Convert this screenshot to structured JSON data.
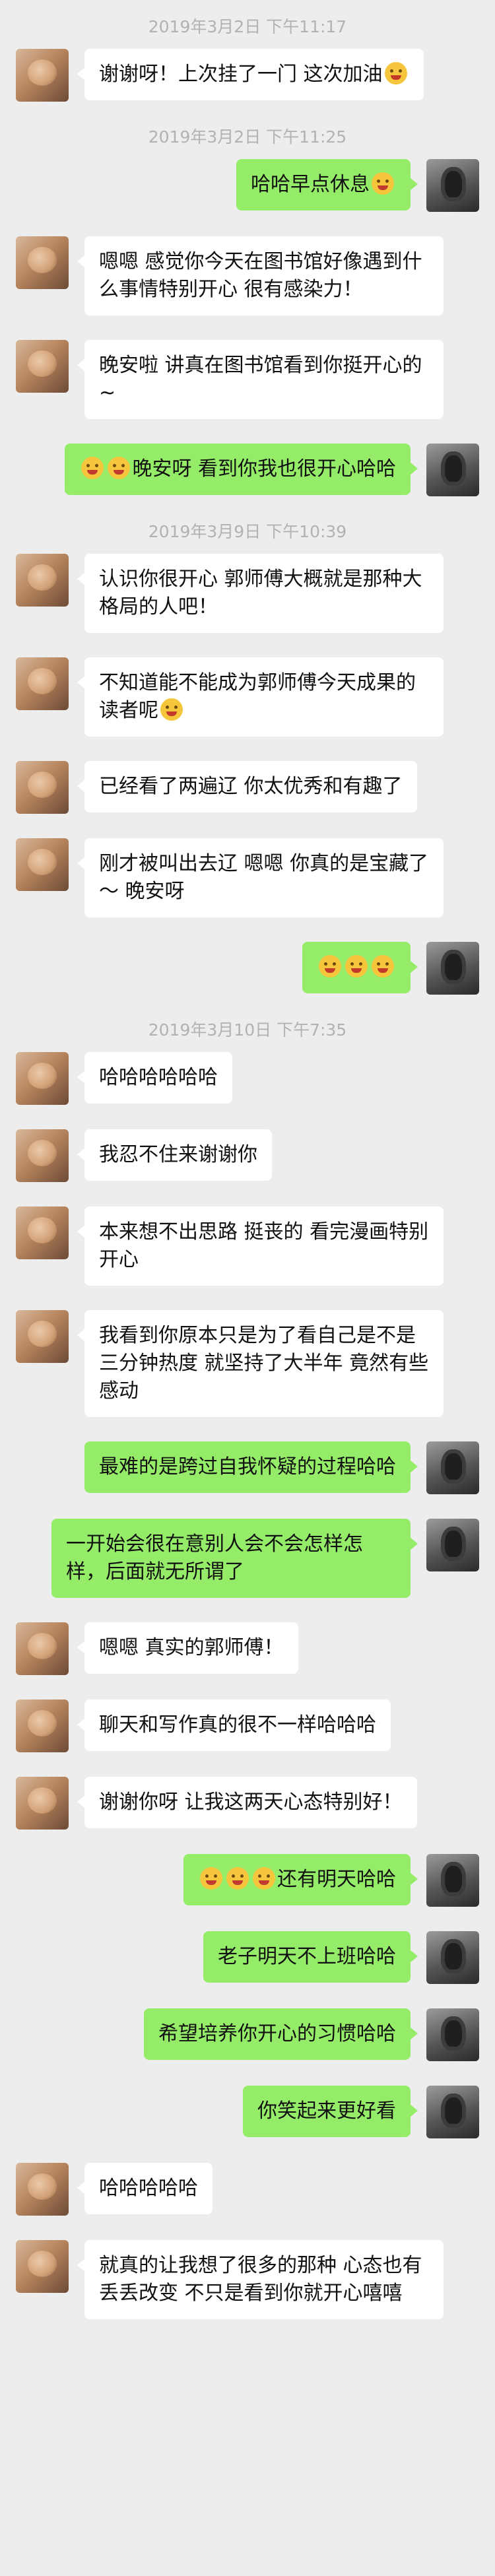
{
  "items": [
    {
      "type": "time",
      "text": "2019年3月2日 下午11:17"
    },
    {
      "type": "msg",
      "side": "left",
      "text": "谢谢呀！上次挂了一门 这次加油",
      "emoji_after": 1
    },
    {
      "type": "time",
      "text": "2019年3月2日 下午11:25"
    },
    {
      "type": "msg",
      "side": "right",
      "text": "哈哈早点休息",
      "emoji_after": 1
    },
    {
      "type": "msg",
      "side": "left",
      "text": "嗯嗯 感觉你今天在图书馆好像遇到什么事情特别开心 很有感染力！"
    },
    {
      "type": "msg",
      "side": "left",
      "text": "晚安啦 讲真在图书馆看到你挺开心的~"
    },
    {
      "type": "msg",
      "side": "right",
      "text": "晚安呀 看到你我也很开心哈哈",
      "emoji_before": 2
    },
    {
      "type": "time",
      "text": "2019年3月9日 下午10:39"
    },
    {
      "type": "msg",
      "side": "left",
      "text": "认识你很开心 郭师傅大概就是那种大格局的人吧！"
    },
    {
      "type": "msg",
      "side": "left",
      "text": "不知道能不能成为郭师傅今天成果的读者呢",
      "emoji_after": 1
    },
    {
      "type": "msg",
      "side": "left",
      "text": "已经看了两遍辽 你太优秀和有趣了"
    },
    {
      "type": "msg",
      "side": "left",
      "text": "刚才被叫出去辽 嗯嗯 你真的是宝藏了～ 晚安呀"
    },
    {
      "type": "msg",
      "side": "right",
      "text": "",
      "emoji_before": 3
    },
    {
      "type": "time",
      "text": "2019年3月10日 下午7:35"
    },
    {
      "type": "msg",
      "side": "left",
      "text": "哈哈哈哈哈哈"
    },
    {
      "type": "msg",
      "side": "left",
      "text": "我忍不住来谢谢你"
    },
    {
      "type": "msg",
      "side": "left",
      "text": "本来想不出思路 挺丧的 看完漫画特别开心"
    },
    {
      "type": "msg",
      "side": "left",
      "text": "我看到你原本只是为了看自己是不是三分钟热度 就坚持了大半年 竟然有些感动"
    },
    {
      "type": "msg",
      "side": "right",
      "text": "最难的是跨过自我怀疑的过程哈哈"
    },
    {
      "type": "msg",
      "side": "right",
      "text": "一开始会很在意别人会不会怎样怎样，后面就无所谓了"
    },
    {
      "type": "msg",
      "side": "left",
      "text": "嗯嗯 真实的郭师傅！"
    },
    {
      "type": "msg",
      "side": "left",
      "text": "聊天和写作真的很不一样哈哈哈"
    },
    {
      "type": "msg",
      "side": "left",
      "text": "谢谢你呀 让我这两天心态特别好！"
    },
    {
      "type": "msg",
      "side": "right",
      "text": "还有明天哈哈",
      "emoji_before": 3
    },
    {
      "type": "msg",
      "side": "right",
      "text": "老子明天不上班哈哈"
    },
    {
      "type": "msg",
      "side": "right",
      "text": "希望培养你开心的习惯哈哈"
    },
    {
      "type": "msg",
      "side": "right",
      "text": "你笑起来更好看"
    },
    {
      "type": "msg",
      "side": "left",
      "text": "哈哈哈哈哈"
    },
    {
      "type": "msg",
      "side": "left",
      "text": "就真的让我想了很多的那种 心态也有丢丢改变 不只是看到你就开心嘻嘻"
    }
  ]
}
